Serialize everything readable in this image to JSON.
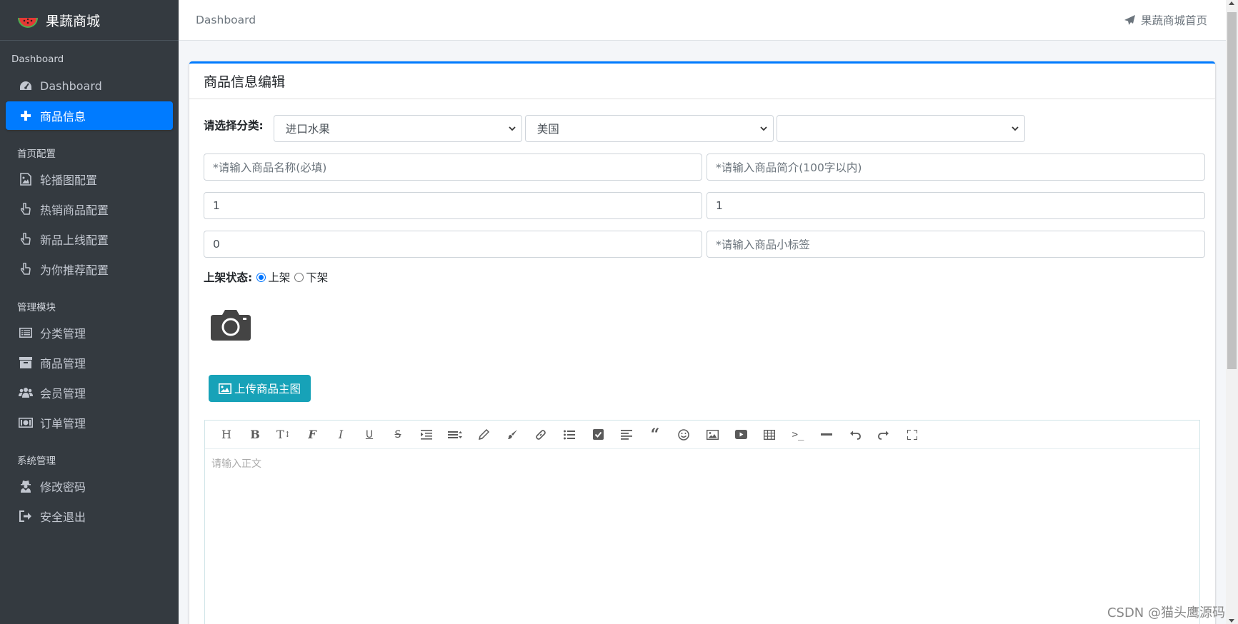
{
  "brand": {
    "title": "果蔬商城",
    "logo_icon": "watermelon-icon"
  },
  "sidebar": {
    "sections": [
      {
        "header": "Dashboard",
        "items": [
          {
            "label": "Dashboard",
            "icon": "tachometer-icon",
            "active": false
          },
          {
            "label": "商品信息",
            "icon": "plus-icon",
            "active": true
          }
        ]
      },
      {
        "header": "首页配置",
        "items": [
          {
            "label": "轮播图配置",
            "icon": "image-file-icon"
          },
          {
            "label": "热销商品配置",
            "icon": "hand-pointer-icon"
          },
          {
            "label": "新品上线配置",
            "icon": "hand-pointer-icon"
          },
          {
            "label": "为你推荐配置",
            "icon": "hand-pointer-icon"
          }
        ]
      },
      {
        "header": "管理模块",
        "items": [
          {
            "label": "分类管理",
            "icon": "list-icon"
          },
          {
            "label": "商品管理",
            "icon": "archive-icon"
          },
          {
            "label": "会员管理",
            "icon": "users-icon"
          },
          {
            "label": "订单管理",
            "icon": "money-icon"
          }
        ]
      },
      {
        "header": "系统管理",
        "items": [
          {
            "label": "修改密码",
            "icon": "user-secret-icon"
          },
          {
            "label": "安全退出",
            "icon": "sign-out-icon"
          }
        ]
      }
    ]
  },
  "topbar": {
    "breadcrumb": "Dashboard",
    "home_link": "果蔬商城首页",
    "home_icon": "paper-plane-icon"
  },
  "card": {
    "title": "商品信息编辑",
    "category_label": "请选择分类:",
    "category_selects": [
      "进口水果",
      "美国",
      ""
    ],
    "fields": {
      "name_placeholder": "*请输入商品名称(必填)",
      "intro_placeholder": "*请输入商品简介(100字以内)",
      "original_price": "1",
      "selling_price": "1",
      "stock": "0",
      "tag_placeholder": "*请输入商品小标签"
    },
    "status_label": "上架状态:",
    "status_options": [
      "上架",
      "下架"
    ],
    "status_selected": "上架",
    "upload_button": "上传商品主图",
    "editor_placeholder": "请输入正文",
    "editor_tools": [
      "heading-icon",
      "bold-icon",
      "font-size-icon",
      "font-family-icon",
      "italic-icon",
      "underline-icon",
      "strikethrough-icon",
      "indent-icon",
      "line-height-icon",
      "pen-icon",
      "brush-icon",
      "link-icon",
      "bulleted-list-icon",
      "checkbox-icon",
      "align-icon",
      "quote-icon",
      "emoji-icon",
      "image-icon",
      "video-icon",
      "table-icon",
      "code-icon",
      "divider-icon",
      "undo-icon",
      "redo-icon",
      "fullscreen-icon"
    ]
  },
  "watermark": "CSDN @猫头鹰源码",
  "colors": {
    "sidebar": "#343a40",
    "primary": "#007bff",
    "info": "#17a2b8"
  }
}
